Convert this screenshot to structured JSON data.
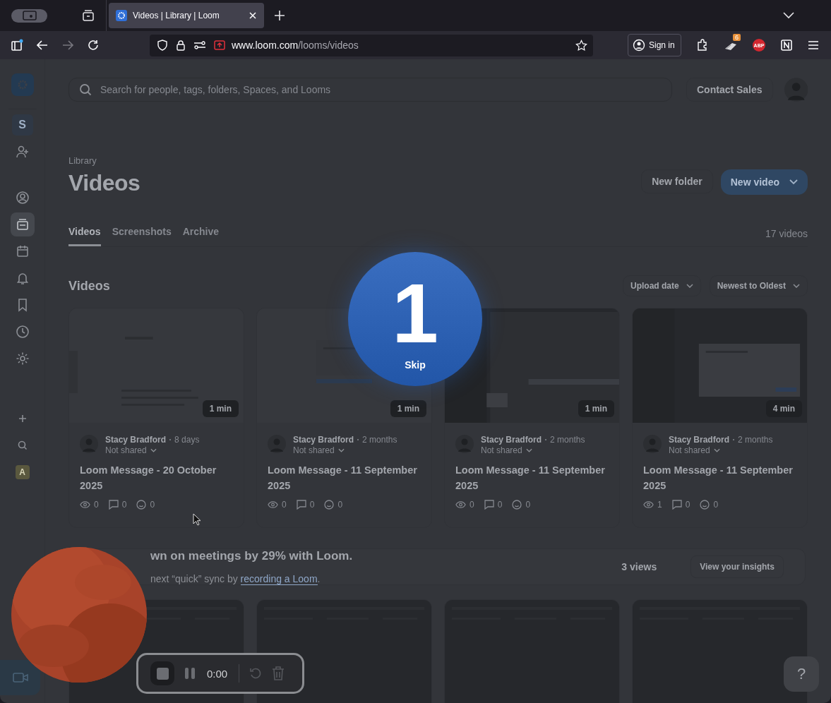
{
  "browser": {
    "tabs": [
      {
        "title": "Videos | Library | Loom",
        "selected": true
      }
    ],
    "url_host": "www.loom.com",
    "url_path": "/looms/videos",
    "sign_in": "Sign in",
    "extension_badge": "6",
    "abp": "ABP"
  },
  "sidebar": {
    "items": [
      {
        "kind": "workspace",
        "label": "S",
        "selected": false
      },
      {
        "kind": "invite",
        "selected": false
      },
      {
        "kind": "profile",
        "selected": false
      },
      {
        "kind": "library",
        "selected": true
      },
      {
        "kind": "calendar",
        "selected": false
      },
      {
        "kind": "bell",
        "selected": false
      },
      {
        "kind": "bookmark",
        "selected": false
      },
      {
        "kind": "clock",
        "selected": false
      },
      {
        "kind": "gear",
        "selected": false
      },
      {
        "kind": "plus",
        "selected": false
      },
      {
        "kind": "search",
        "selected": false
      },
      {
        "kind": "avatar",
        "label": "A",
        "selected": false
      }
    ]
  },
  "header": {
    "search_placeholder": "Search for people, tags, folders, Spaces, and Looms",
    "contact_sales": "Contact Sales"
  },
  "page": {
    "breadcrumb": "Library",
    "title": "Videos",
    "new_folder": "New folder",
    "new_video": "New video",
    "tabs": [
      {
        "label": "Videos",
        "selected": true
      },
      {
        "label": "Screenshots",
        "selected": false
      },
      {
        "label": "Archive",
        "selected": false
      }
    ],
    "count": "17 videos",
    "section_title": "Videos",
    "filters": [
      "Upload date",
      "Newest to Oldest"
    ]
  },
  "cards": [
    {
      "duration": "1 min",
      "author": "Stacy Bradford",
      "age": "8 days",
      "sharing": "Not shared",
      "title": "Loom Message - 20 October 2025",
      "views": "0",
      "comments": "0",
      "reactions": "0"
    },
    {
      "duration": "1 min",
      "author": "Stacy Bradford",
      "age": "2 months",
      "sharing": "Not shared",
      "title": "Loom Message - 11 September 2025",
      "views": "0",
      "comments": "0",
      "reactions": "0"
    },
    {
      "duration": "1 min",
      "author": "Stacy Bradford",
      "age": "2 months",
      "sharing": "Not shared",
      "title": "Loom Message - 11 September 2025",
      "views": "0",
      "comments": "0",
      "reactions": "0"
    },
    {
      "duration": "4 min",
      "author": "Stacy Bradford",
      "age": "2 months",
      "sharing": "Not shared",
      "title": "Loom Message - 11 September 2025",
      "views": "1",
      "comments": "0",
      "reactions": "0"
    }
  ],
  "banner": {
    "headline": "wn on meetings by 29% with Loom.",
    "line_start": "next “quick” sync by ",
    "link": "recording a Loom",
    "line_end": ".",
    "views": "3 views",
    "button": "View your insights"
  },
  "countdown": {
    "number": "1",
    "skip": "Skip"
  },
  "recorder": {
    "time": "0:00"
  },
  "help": "?"
}
